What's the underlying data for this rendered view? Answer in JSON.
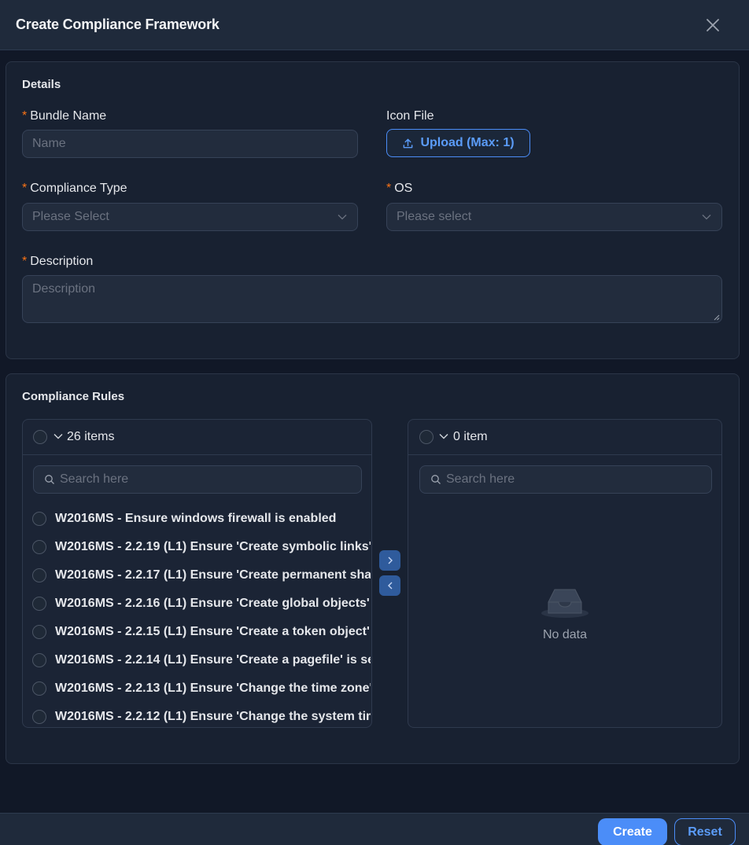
{
  "dialog": {
    "title": "Create Compliance Framework"
  },
  "details": {
    "section_title": "Details",
    "bundle_name": {
      "label": "Bundle Name",
      "placeholder": "Name"
    },
    "icon_file": {
      "label": "Icon File",
      "upload_label": "Upload (Max: 1)"
    },
    "compliance_type": {
      "label": "Compliance Type",
      "placeholder": "Please Select"
    },
    "os": {
      "label": "OS",
      "placeholder": "Please select"
    },
    "description": {
      "label": "Description",
      "placeholder": "Description"
    },
    "required_mark": "*"
  },
  "rules": {
    "section_title": "Compliance Rules",
    "source": {
      "count_label": "26 items",
      "search_placeholder": "Search here",
      "items": [
        "W2016MS - Ensure windows firewall is enabled",
        "W2016MS - 2.2.19 (L1) Ensure 'Create symbolic links' is set to 'Administrators'",
        "W2016MS - 2.2.17 (L1) Ensure 'Create permanent shared objects' is set to 'No One'",
        "W2016MS - 2.2.16 (L1) Ensure 'Create global objects' is set to 'Administrators'",
        "W2016MS - 2.2.15 (L1) Ensure 'Create a token object' is set to 'No One'",
        "W2016MS - 2.2.14 (L1) Ensure 'Create a pagefile' is set to 'Administrators'",
        "W2016MS - 2.2.13 (L1) Ensure 'Change the time zone' is set to 'Administrators'",
        "W2016MS - 2.2.12 (L1) Ensure 'Change the system time' is set to 'Administrators'"
      ]
    },
    "target": {
      "count_label": "0 item",
      "search_placeholder": "Search here",
      "empty_text": "No data"
    }
  },
  "footer": {
    "create_label": "Create",
    "reset_label": "Reset"
  },
  "colors": {
    "accent": "#4b8df8",
    "required": "#f97316",
    "background": "#111827",
    "card": "#182131"
  }
}
